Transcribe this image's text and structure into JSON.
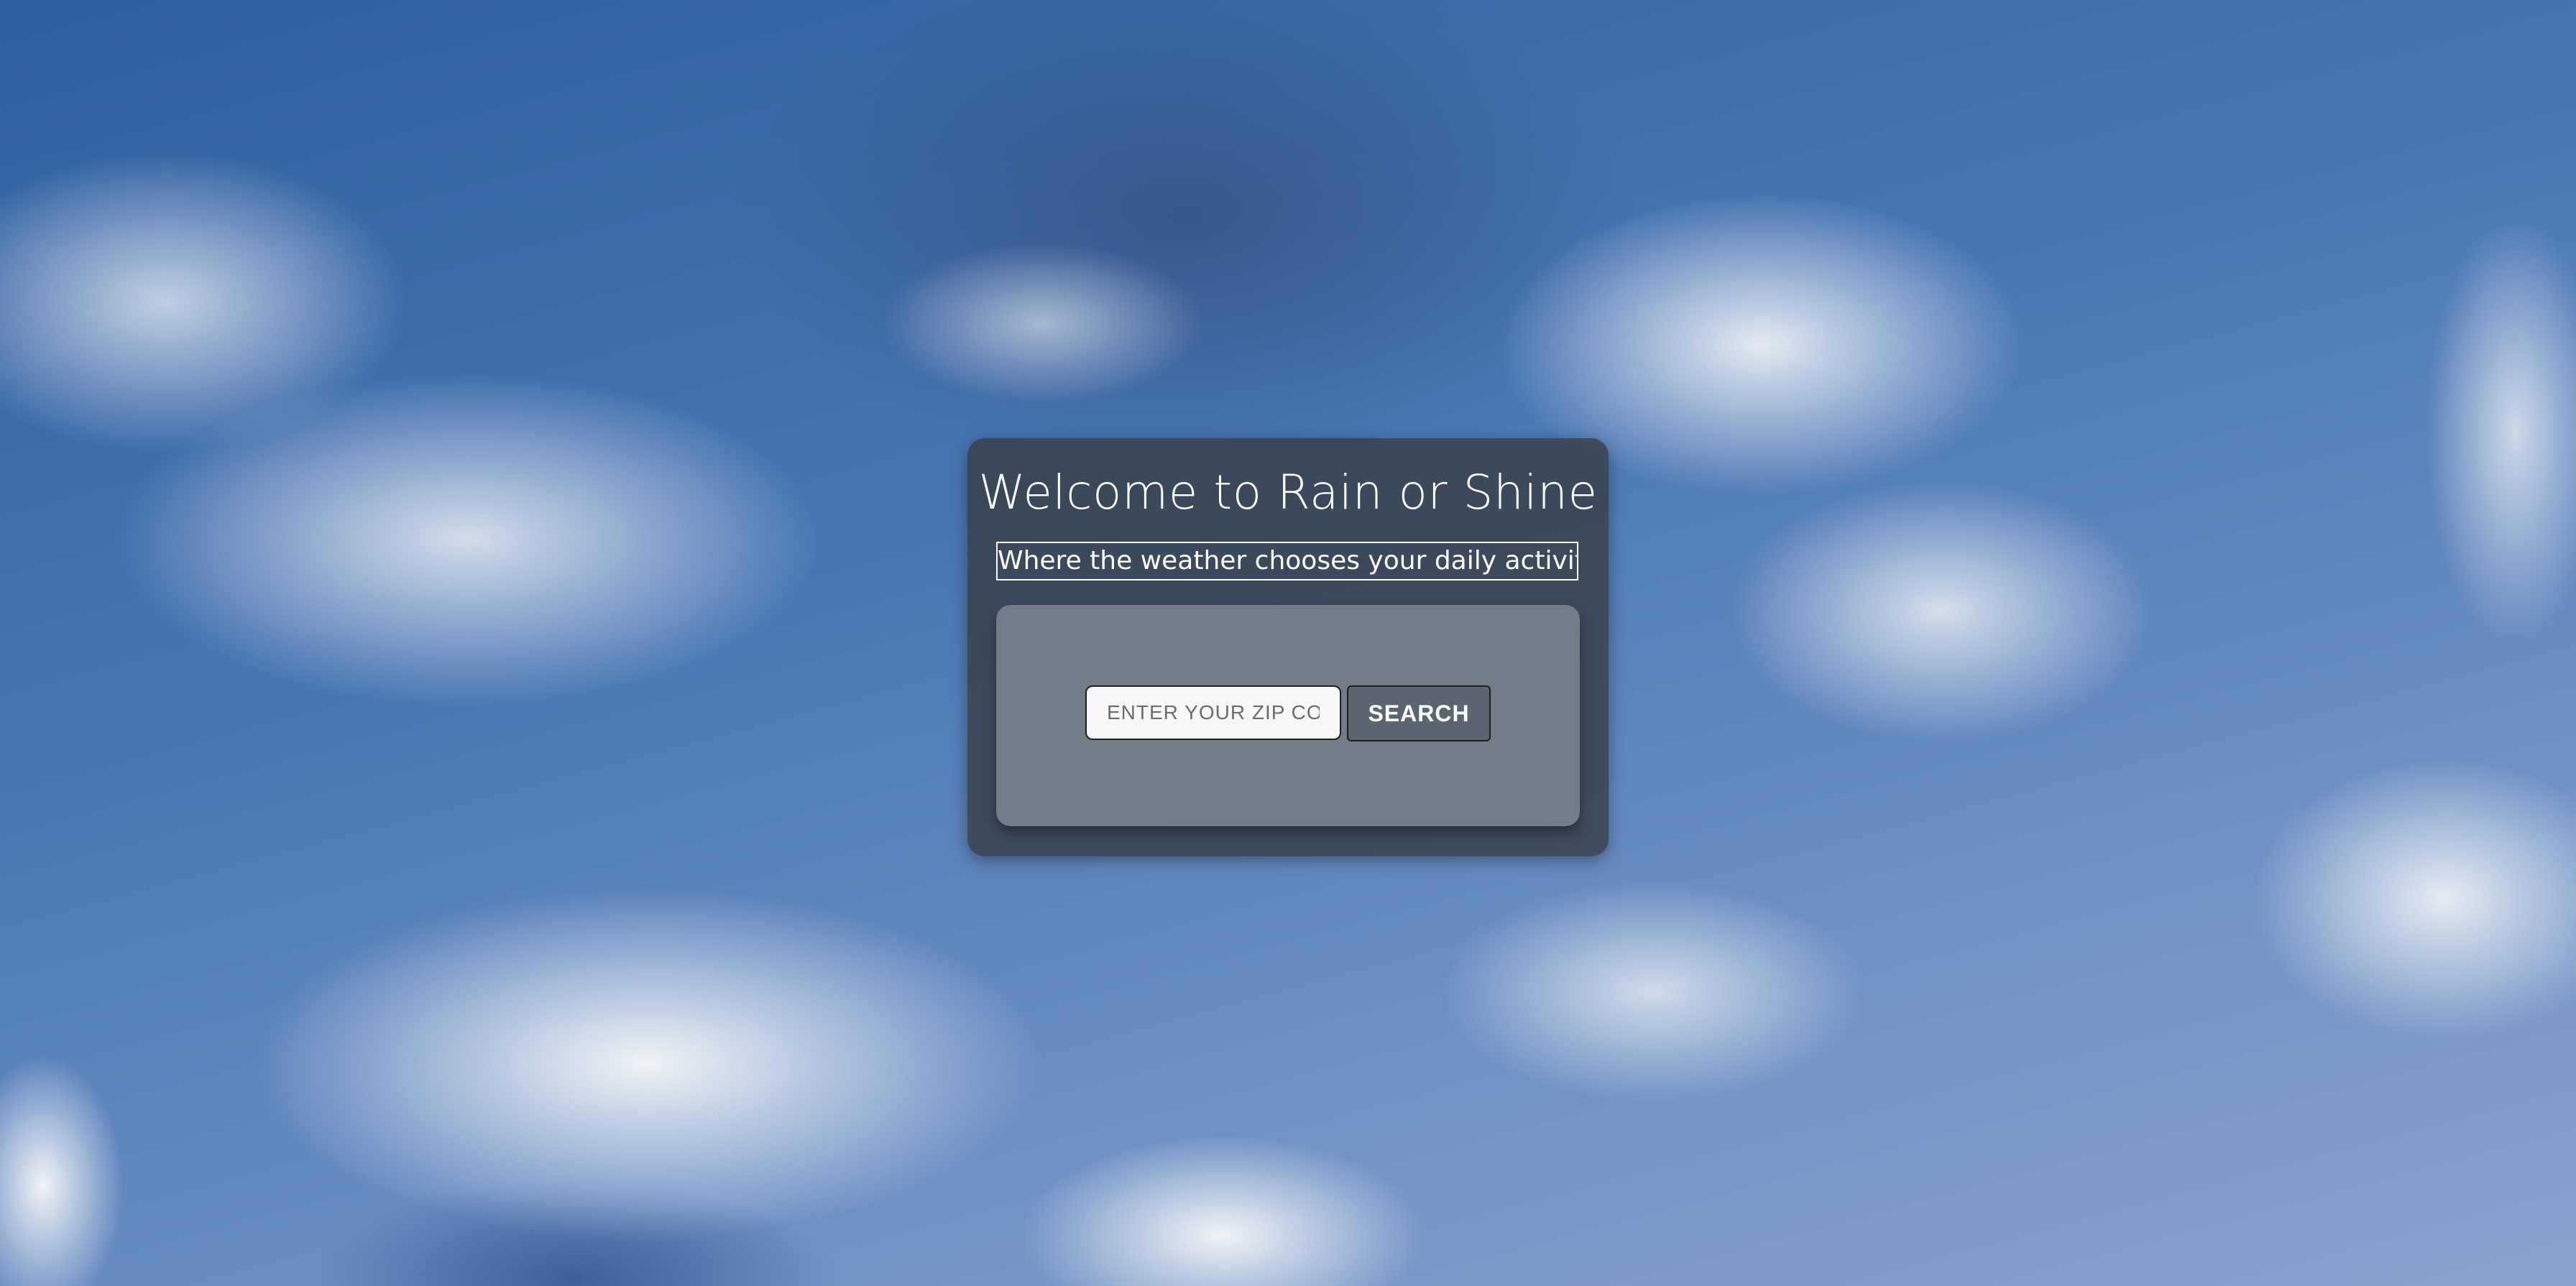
{
  "welcome": {
    "title": "Welcome to Rain or Shine",
    "tagline": "Where the weather chooses your daily activity!"
  },
  "search": {
    "placeholder": "ENTER YOUR ZIP CODE",
    "value": "",
    "button_label": "SEARCH"
  },
  "colors": {
    "card_background": "#373e48",
    "panel_background": "#737c89",
    "button_background": "#5b6572",
    "text": "#ffffff"
  }
}
